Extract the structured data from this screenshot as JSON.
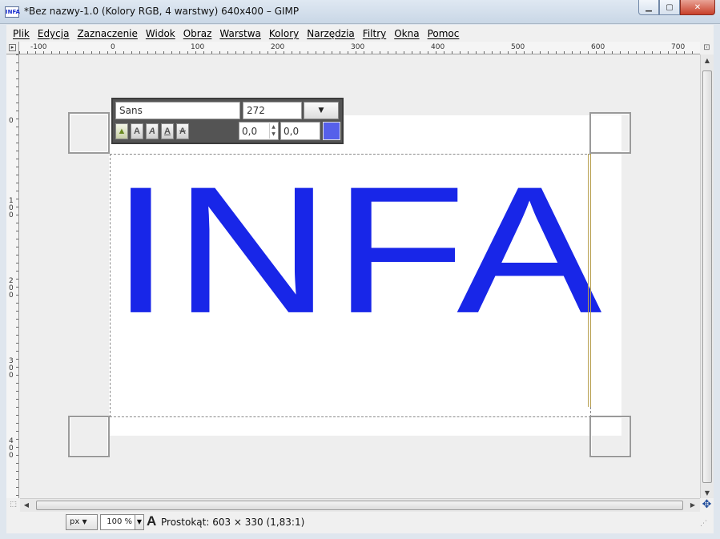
{
  "window": {
    "icon_label": "INFA",
    "title": "*Bez nazwy-1.0 (Kolory RGB, 4 warstwy) 640x400 – GIMP",
    "minimize": "▁",
    "maximize": "▢",
    "close": "✕"
  },
  "menubar": {
    "items": [
      {
        "label": "Plik"
      },
      {
        "label": "Edycja"
      },
      {
        "label": "Zaznaczenie"
      },
      {
        "label": "Widok"
      },
      {
        "label": "Obraz"
      },
      {
        "label": "Warstwa"
      },
      {
        "label": "Kolory"
      },
      {
        "label": "Narzędzia"
      },
      {
        "label": "Filtry"
      },
      {
        "label": "Okna"
      },
      {
        "label": "Pomoc"
      }
    ]
  },
  "rulers": {
    "horizontal_labels": [
      "-100",
      "0",
      "100",
      "200",
      "300",
      "400",
      "500",
      "600",
      "700"
    ],
    "vertical_labels": [
      "0",
      "100",
      "200",
      "300",
      "400"
    ]
  },
  "canvas": {
    "text_layer_content": "INFA",
    "text_color": "#1826e8"
  },
  "text_toolbar": {
    "font": "Sans",
    "size": "272",
    "size_dropdown_arrow": "▼",
    "baseline_offset": "0,0",
    "kerning": "0,0",
    "style_buttons": [
      "A",
      "A",
      "A",
      "A"
    ],
    "color": "#5660ea"
  },
  "statusbar": {
    "unit": "px",
    "unit_arrow": "▼",
    "zoom": "100 %",
    "zoom_arrow": "▼",
    "tool_icon": "A",
    "status": "Prostokąt: 603 × 330  (1,83:1)"
  }
}
